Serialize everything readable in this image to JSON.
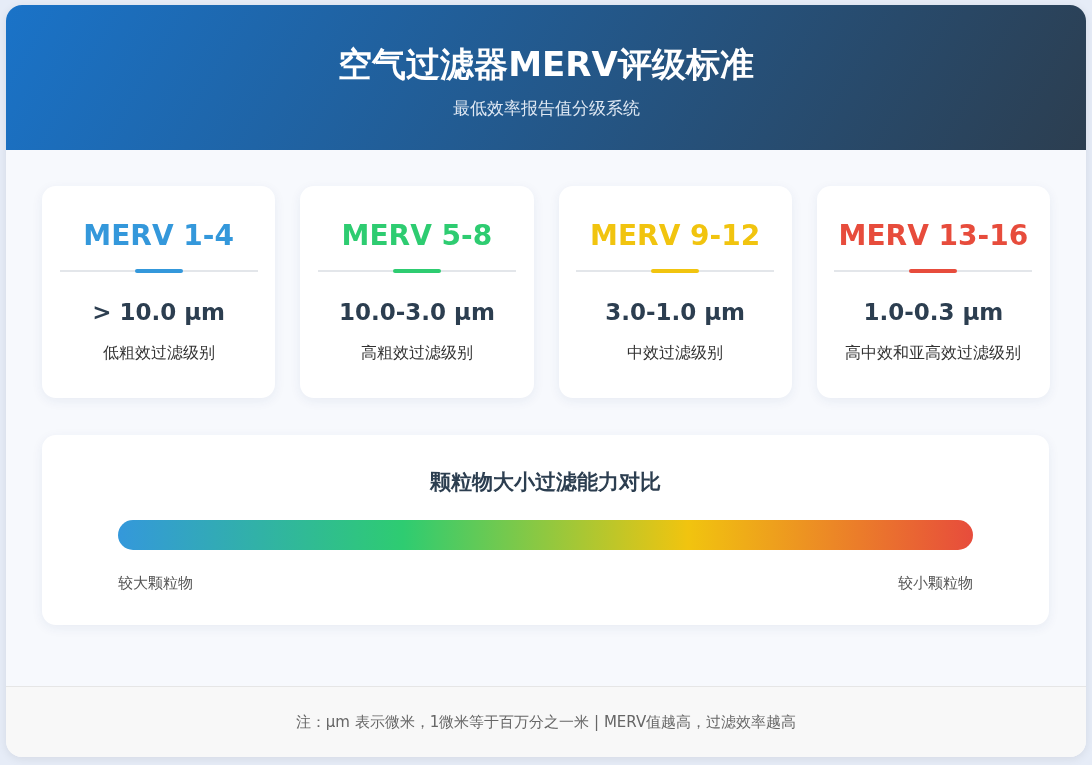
{
  "header": {
    "title": "空气过滤器MERV评级标准",
    "subtitle": "最低效率报告值分级系统"
  },
  "ratings": [
    {
      "name": "MERV 1-4",
      "color": "#3498db",
      "size": "> 10.0 μm",
      "description": "低粗效过滤级别"
    },
    {
      "name": "MERV 5-8",
      "color": "#2ecc71",
      "size": "10.0-3.0 μm",
      "description": "高粗效过滤级别"
    },
    {
      "name": "MERV 9-12",
      "color": "#f1c40f",
      "size": "3.0-1.0 μm",
      "description": "中效过滤级别"
    },
    {
      "name": "MERV 13-16",
      "color": "#e74c3c",
      "size": "1.0-0.3 μm",
      "description": "高中效和亚高效过滤级别"
    }
  ],
  "comparison": {
    "title": "颗粒物大小过滤能力对比",
    "left_label": "较大颗粒物",
    "right_label": "较小颗粒物"
  },
  "footer": {
    "note": "注：μm 表示微米，1微米等于百万分之一米 | MERV值越高，过滤效率越高"
  }
}
